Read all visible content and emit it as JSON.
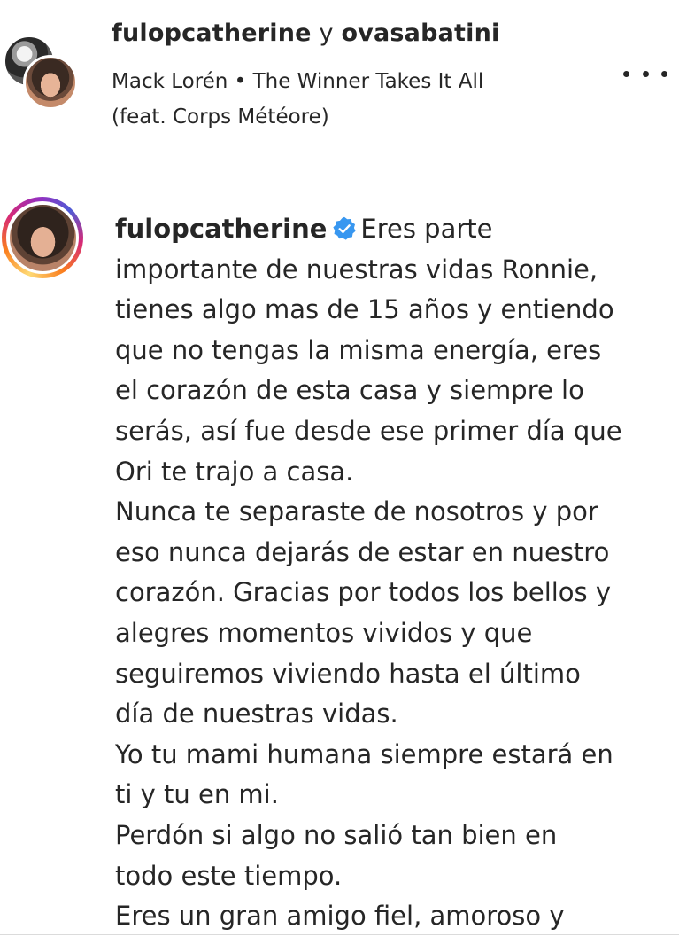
{
  "header": {
    "user_primary": "fulopcatherine",
    "conjunction": "y",
    "user_secondary": "ovasabatini",
    "audio_line1": "Mack Lorén • The Winner Takes It All",
    "audio_line2": "(feat. Corps Météore)",
    "more_icon": "more-horizontal-icon"
  },
  "caption": {
    "username": "fulopcatherine",
    "verified_icon": "verified-badge-icon",
    "verified_color": "#3897f0",
    "first_line_text": "Eres parte",
    "lines": [
      "importante de nuestras vidas Ronnie,",
      "tienes algo mas de 15 años y entiendo",
      "que no tengas la misma energía, eres",
      "el corazón de esta casa y siempre lo",
      "serás, así fue desde ese primer día que",
      "Ori te trajo a casa.",
      "Nunca te separaste de nosotros y por",
      "eso nunca dejarás de estar en nuestro",
      "corazón. Gracias por todos los bellos y",
      "alegres momentos vividos y que",
      "seguiremos viviendo hasta el último",
      "día de nuestras vidas.",
      "Yo tu mami humana siempre estará en",
      "ti y tu en mi.",
      "Perdón si algo no salió tan bien en",
      "todo este tiempo.",
      "Eres un gran amigo fiel, amoroso y"
    ]
  },
  "colors": {
    "text": "#262626",
    "divider": "#dbdbdb",
    "story_ring": [
      "#feda75",
      "#fa7e1e",
      "#d62976",
      "#962fbf",
      "#4f5bd5"
    ]
  }
}
